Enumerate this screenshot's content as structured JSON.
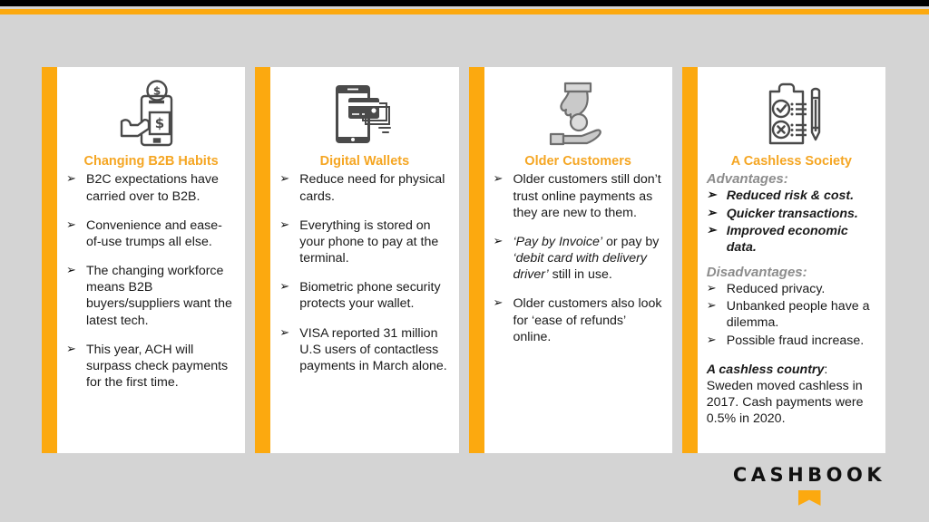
{
  "theme": {
    "background": "#d4d4d4",
    "accent_orange": "#FCA90F",
    "heading_orange": "#F5A623",
    "top_bar_black": "#000000",
    "card_white": "#ffffff",
    "icon_dark_gray": "#4a4a4a",
    "icon_light_gray": "#b5b5b5",
    "subheading_gray": "#8c8c8c"
  },
  "columns": [
    {
      "icon": "smartphone-payment-hand-icon",
      "heading": "Changing B2B Habits",
      "bullets": [
        "B2C expectations have carried over to B2B.",
        "Convenience and ease-of-use trumps all else.",
        "The changing workforce means B2B buyers/suppliers want the latest tech.",
        "This year, ACH will surpass check payments for the first time."
      ]
    },
    {
      "icon": "phone-cards-wallet-icon",
      "heading": "Digital Wallets",
      "bullets": [
        "Reduce need for physical cards.",
        "Everything is stored on your phone to pay at the terminal.",
        "Biometric phone security protects your wallet.",
        "VISA reported 31 million U.S users of contactless payments in March alone."
      ]
    },
    {
      "icon": "hand-giving-coin-icon",
      "heading": "Older Customers",
      "bullets_rich": [
        [
          {
            "text": "Older customers still don’t trust online payments as they are new to them.",
            "style": "normal"
          }
        ],
        [
          {
            "text": "‘Pay by Invoice’",
            "style": "italic"
          },
          {
            "text": " or pay by ",
            "style": "normal"
          },
          {
            "text": "‘debit card with delivery driver’",
            "style": "italic"
          },
          {
            "text": " still in use.",
            "style": "normal"
          }
        ],
        [
          {
            "text": "Older customers also look for ‘ease of refunds’ online.",
            "style": "normal"
          }
        ]
      ]
    },
    {
      "icon": "clipboard-checklist-pencil-icon",
      "heading": "A Cashless Society",
      "advantages_label": "Advantages:",
      "advantages": [
        "Reduced risk & cost.",
        "Quicker transactions.",
        "Improved economic data."
      ],
      "disadvantages_label": "Disadvantages:",
      "disadvantages": [
        "Reduced privacy.",
        "Unbanked people have a dilemma.",
        "Possible fraud increase."
      ],
      "note": [
        {
          "text": "A cashless country",
          "style": "bolditalic"
        },
        {
          "text": ": Sweden moved cashless in 2017. Cash payments were 0.5% in 2020.",
          "style": "normal"
        }
      ]
    }
  ],
  "logo": {
    "wordmark": "CASHBOOK",
    "mark": "bookmark-shape"
  }
}
